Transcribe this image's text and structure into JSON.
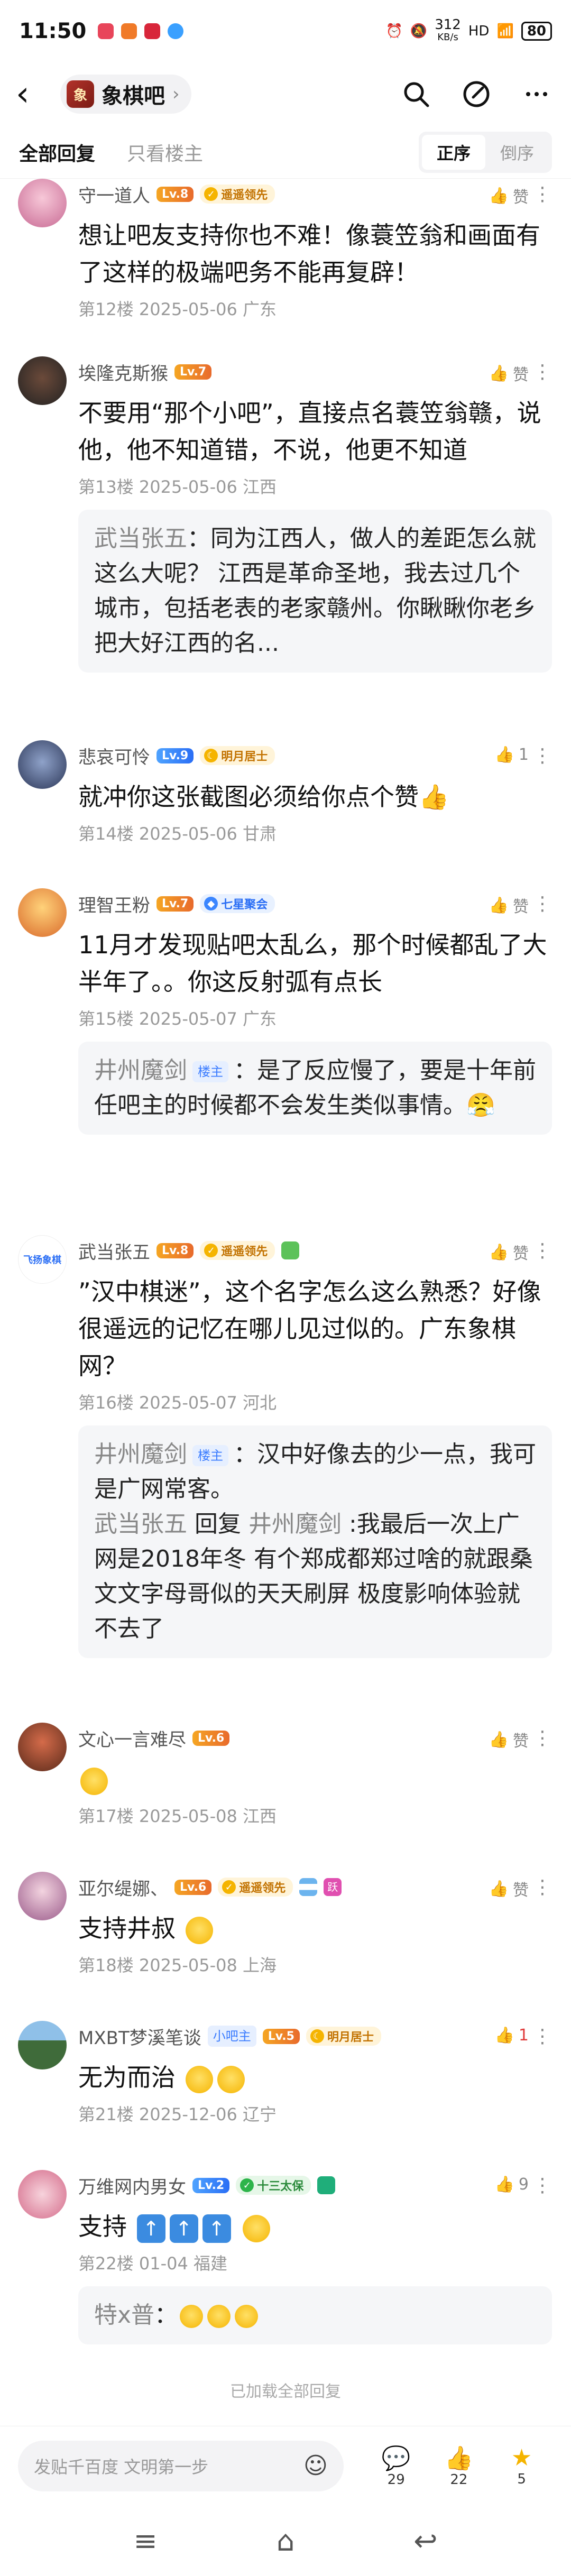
{
  "status_bar": {
    "time": "11:50",
    "speed": "312",
    "speed_unit": "KB/s",
    "battery": "80"
  },
  "header": {
    "forum_name": "象棋吧",
    "forum_logo_text": "象"
  },
  "tabs": {
    "all": "全部回复",
    "op_only": "只看楼主",
    "sort_asc": "正序",
    "sort_desc": "倒序"
  },
  "posts": [
    {
      "user": "守一道人",
      "level": "Lv.8",
      "tag": "遥遥领先",
      "like": "赞",
      "text": "想让吧友支持你也不难！像蓑笠翁和画面有了这样的极端吧务不能再复辟！",
      "meta": "第12楼 2025-05-06 广东"
    },
    {
      "user": "埃隆克斯猴",
      "level": "Lv.7",
      "like": "赞",
      "text": "不要用“那个小吧”，直接点名蓑笠翁赣，说他，他不知道错，不说，他更不知道",
      "meta": "第13楼 2025-05-06 江西",
      "quote": {
        "name": "武当张五",
        "text": "：同为江西人，做人的差距怎么就这么大呢？ 江西是革命圣地，我去过几个城市，包括老表的老家赣州。你瞅瞅你老乡把大好江西的名..."
      }
    },
    {
      "user": "悲哀可怜",
      "level": "Lv.9",
      "tag": "明月居士",
      "like": "1",
      "text": "就冲你这张截图必须给你点个赞👍",
      "meta": "第14楼 2025-05-06 甘肃"
    },
    {
      "user": "理智王粉",
      "level": "Lv.7",
      "tag": "七星聚会",
      "like": "赞",
      "text": "11月才发现贴吧太乱么，那个时候都乱了大半年了。。你这反射弧有点长",
      "meta": "第15楼 2025-05-07 广东",
      "quote": {
        "name": "井州魔剑",
        "host": "楼主",
        "text": "：是了反应慢了，要是十年前任吧主的时候都不会发生类似事情。😤"
      }
    },
    {
      "user": "武当张五",
      "level": "Lv.8",
      "tag": "遥遥领先",
      "like": "赞",
      "text": "”汉中棋迷”，这个名字怎么这么熟悉？好像很遥远的记忆在哪儿见过似的。广东象棋网？",
      "meta": "第16楼 2025-05-07 河北",
      "quote": {
        "name": "井州魔剑",
        "host": "楼主",
        "text": "：汉中好像去的少一点，我可是广网常客。",
        "name2": "武当张五",
        "reply": "回复",
        "name3": "井州魔剑",
        "text2": ":我最后一次上广网是2018年冬 有个郑成都郑过啥的就跟桑文文字母哥似的天天刷屏 极度影响体验就不去了"
      }
    },
    {
      "user": "文心一言难尽",
      "level": "Lv.6",
      "like": "赞",
      "meta": "第17楼 2025-05-08 江西"
    },
    {
      "user": "亚尔缇娜、",
      "level": "Lv.6",
      "tag": "遥遥领先",
      "like": "赞",
      "text": "支持井叔",
      "meta": "第18楼 2025-05-08 上海"
    },
    {
      "user": "MXBT梦溪笔谈",
      "badge": "小吧主",
      "level": "Lv.5",
      "tag": "明月居士",
      "like": "1",
      "text": "无为而治",
      "meta": "第21楼 2025-12-06 辽宁"
    },
    {
      "user": "万维网内男女",
      "level": "Lv.2",
      "tag": "十三太保",
      "like": "9",
      "text": "支持",
      "meta": "第22楼 01-04 福建",
      "quote": {
        "name": "特x普",
        "text": "："
      }
    }
  ],
  "loaded_text": "已加载全部回复",
  "bottom": {
    "input_placeholder": "发贴千百度 文明第一步",
    "comments": "29",
    "likes": "22",
    "favorites": "5"
  }
}
